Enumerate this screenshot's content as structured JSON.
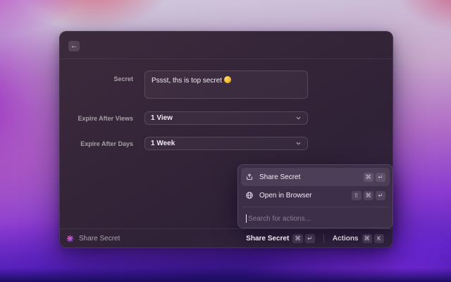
{
  "window": {
    "header": {
      "back_glyph": "←"
    },
    "form": {
      "secret_label": "Secret",
      "secret_value": "Pssst, ths is top secret",
      "secret_emoji": "🤫",
      "views_label": "Expire After Views",
      "views_value": "1 View",
      "days_label": "Expire After Days",
      "days_value": "1 Week"
    },
    "status_bar": {
      "app_title": "Share Secret",
      "primary_action_label": "Share Secret",
      "primary_keys": [
        "⌘",
        "↵"
      ],
      "actions_label": "Actions",
      "actions_keys": [
        "⌘",
        "K"
      ]
    }
  },
  "actions_panel": {
    "items": [
      {
        "icon": "share-upload-icon",
        "label": "Share Secret",
        "keys": [
          "⌘",
          "↵"
        ],
        "selected": true
      },
      {
        "icon": "globe-icon",
        "label": "Open in Browser",
        "keys": [
          "⇧",
          "⌘",
          "↵"
        ],
        "selected": false
      }
    ],
    "search_placeholder": "Search for actions..."
  },
  "colors": {
    "window_bg": "#33243a",
    "popup_bg": "#3e2e49",
    "accent_icon_pink": "#ff5fa2",
    "accent_icon_purple": "#7c4dff",
    "wallpaper_magenta": "#b83cc0",
    "wallpaper_violet": "#7d2fd2",
    "wallpaper_indigo": "#29117a",
    "emoji_yellow": "#edac1c"
  }
}
